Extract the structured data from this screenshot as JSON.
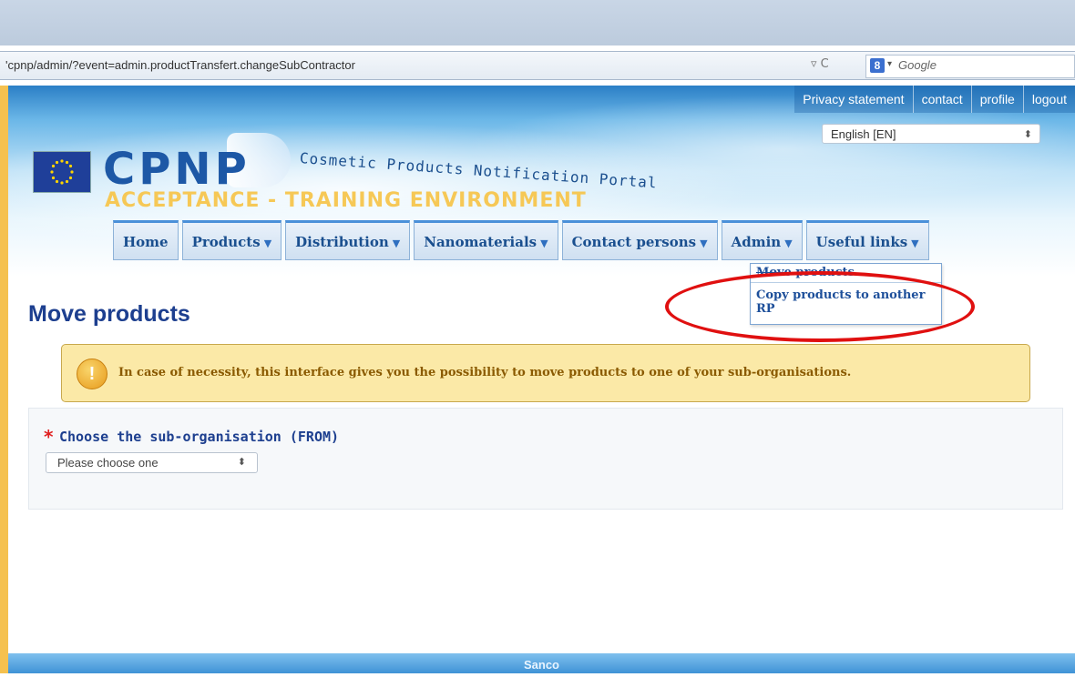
{
  "browser": {
    "url": "'cpnp/admin/?event=admin.productTransfert.changeSubContractor",
    "search_placeholder": "Google",
    "search_engine_icon": "g-plus-icon"
  },
  "header": {
    "top_links": [
      "Privacy statement",
      "contact",
      "profile",
      "logout"
    ],
    "language": "English [EN]",
    "logo_text": "CPNP",
    "tagline": "Cosmetic Products Notification Portal",
    "environment": "ACCEPTANCE - TRAINING ENVIRONMENT"
  },
  "nav": [
    {
      "label": "Home",
      "caret": false
    },
    {
      "label": "Products",
      "caret": true
    },
    {
      "label": "Distribution",
      "caret": true
    },
    {
      "label": "Nanomaterials",
      "caret": true
    },
    {
      "label": "Contact persons",
      "caret": true
    },
    {
      "label": "Admin",
      "caret": true
    },
    {
      "label": "Useful links",
      "caret": true
    }
  ],
  "admin_menu": {
    "items": [
      "Move products",
      "Copy products to another RP"
    ]
  },
  "page": {
    "title": "Move products",
    "alert": "In case of necessity, this interface gives you the possibility to move products to one of your sub-organisations.",
    "field_required_mark": "*",
    "field_label": "Choose the sub-organisation (FROM)",
    "select_value": "Please choose one"
  },
  "footer": {
    "text": "Sanco"
  },
  "colors": {
    "accent": "#1d58a6",
    "highlight": "#e01010",
    "alert_bg": "#fbe9a7"
  }
}
